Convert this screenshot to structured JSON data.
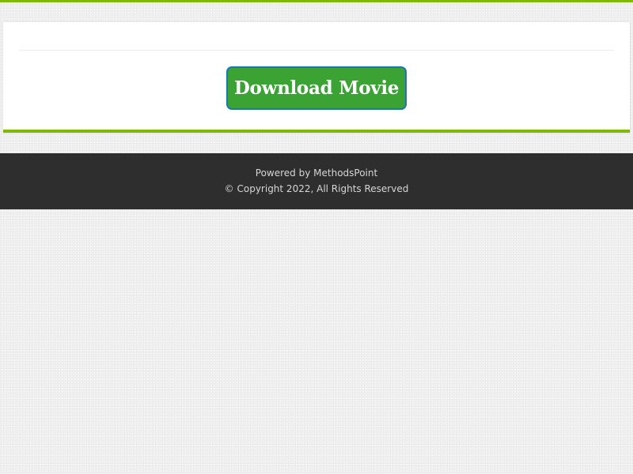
{
  "main": {
    "download_button_label": "Download Movie"
  },
  "footer": {
    "powered_by": "Powered by MethodsPoint",
    "copyright": "© Copyright 2022, All Rights Reserved"
  },
  "colors": {
    "accent_green": "#7fb900",
    "button_green": "#3aa334",
    "button_border_blue": "#1a76b8",
    "footer_background": "#2e2e2e"
  }
}
